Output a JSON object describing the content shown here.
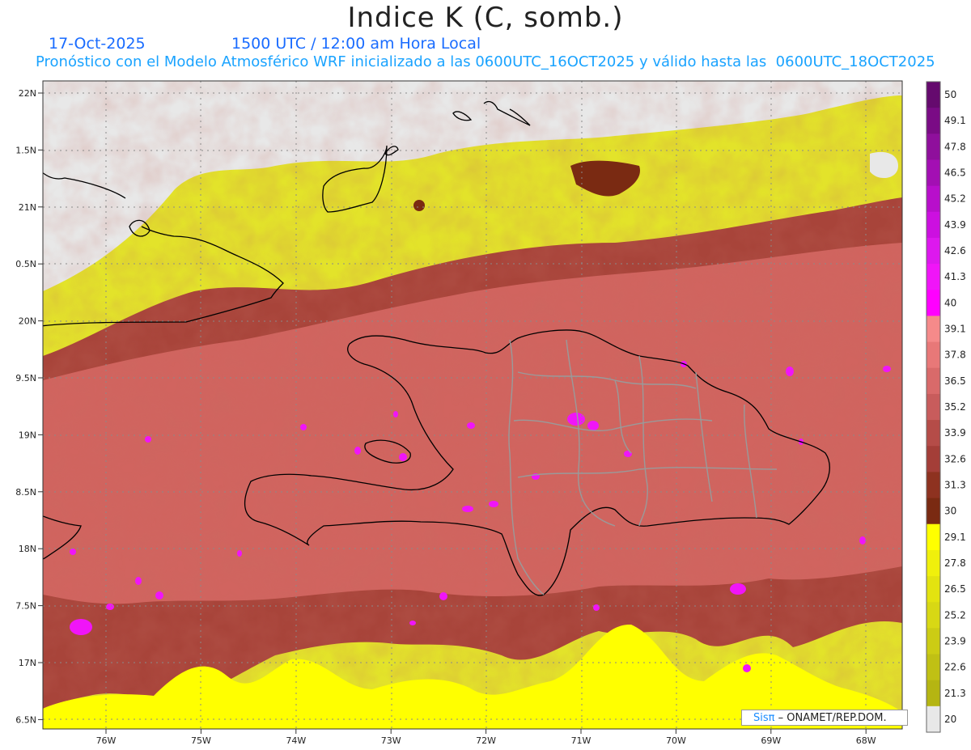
{
  "header": {
    "title": "Indice K (C, somb.)",
    "date": "17-Oct-2025",
    "time": "1500 UTC / 12:00 am Hora Local",
    "model_line": "Pronóstico con el Modelo Atmosférico WRF inicializado a las 0600UTC_16OCT2025 y válido hasta las  0600UTC_18OCT2025"
  },
  "axes": {
    "lat_labels": [
      "22N",
      "1.5N",
      "21N",
      "0.5N",
      "20N",
      "9.5N",
      "19N",
      "8.5N",
      "18N",
      "7.5N",
      "17N",
      "6.5N"
    ],
    "lon_labels": [
      "76W",
      "75W",
      "74W",
      "73W",
      "72W",
      "71W",
      "70W",
      "69W",
      "68W"
    ]
  },
  "colorbar": {
    "levels": [
      "50",
      "49.1",
      "47.8",
      "46.5",
      "45.2",
      "43.9",
      "42.6",
      "41.3",
      "40",
      "39.1",
      "37.8",
      "36.5",
      "35.2",
      "33.9",
      "32.6",
      "31.3",
      "30",
      "29.1",
      "27.8",
      "26.5",
      "25.2",
      "23.9",
      "22.6",
      "21.3",
      "20"
    ],
    "colors": [
      "#650a6e",
      "#7a0b85",
      "#8f0f9c",
      "#a30fb3",
      "#b80fcb",
      "#cc10e0",
      "#dd18ee",
      "#f015f8",
      "#ff00ff",
      "#f58a8a",
      "#e87878",
      "#d96a6a",
      "#c85c5c",
      "#b54c48",
      "#a43e38",
      "#8e3220",
      "#7a2a12",
      "#ffff00",
      "#f0f00c",
      "#e3e310",
      "#d8d814",
      "#cccc14",
      "#c0c014",
      "#b5b512",
      "#e8e8e8"
    ]
  },
  "legend_colors": {
    "ocean_gray": "#e8e8e8",
    "coast": "#000000",
    "provinces": "#9a9a9a"
  },
  "credit": {
    "brand": "Sisπ",
    "text": "– ONAMET/REP.DOM."
  }
}
